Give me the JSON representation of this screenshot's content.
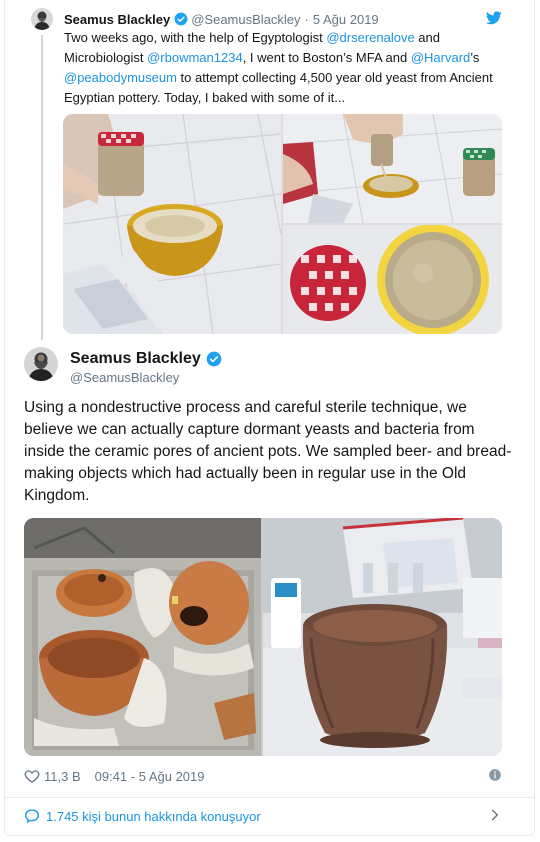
{
  "quoted": {
    "name": "Seamus Blackley",
    "handle": "@SeamusBlackley",
    "separator": "·",
    "date": "5 Ağu 2019",
    "text_parts": [
      {
        "t": "Two weeks ago, with the help of Egyptologist ",
        "mention": false
      },
      {
        "t": "@drserenalove",
        "mention": true
      },
      {
        "t": " and Microbiologist ",
        "mention": false
      },
      {
        "t": "@rbowman1234",
        "mention": true
      },
      {
        "t": ", I went to Boston’s MFA and ",
        "mention": false
      },
      {
        "t": "@Harvard",
        "mention": true
      },
      {
        "t": "’s ",
        "mention": false
      },
      {
        "t": "@peabodymuseum",
        "mention": true
      },
      {
        "t": " to attempt collecting 4,500 year old yeast from Ancient Egyptian pottery. Today, I baked with some of it...",
        "mention": false
      }
    ],
    "icons": {
      "verified": "verified-badge-icon",
      "brand": "twitter-bird-icon"
    }
  },
  "main": {
    "name": "Seamus Blackley",
    "handle": "@SeamusBlackley",
    "text": "Using a nondestructive process and careful sterile technique, we believe we can actually capture dormant yeasts and bacteria from inside the ceramic pores of ancient pots. We sampled beer- and bread-making objects which had actually been in regular use in the Old Kingdom."
  },
  "stats": {
    "likes": "11,3 B",
    "timestamp": "09:41 - 5 Ağu 2019"
  },
  "conversation": {
    "label": "1.745 kişi bunun hakkında konuşuyor"
  },
  "colors": {
    "accent": "#1b95e0",
    "muted": "#657786",
    "text": "#14171a",
    "border": "#e6ecf0"
  }
}
